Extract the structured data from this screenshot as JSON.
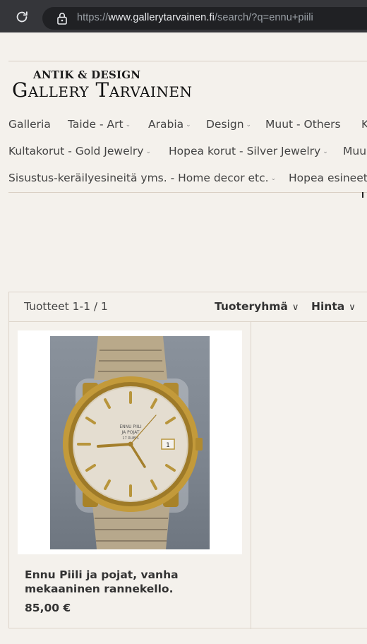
{
  "browser": {
    "url_prefix": "https://",
    "url_host": "www.gallerytarvainen.fi",
    "url_path": "/search/?q=ennu+piili"
  },
  "logo": {
    "line1": "ANTIK & DESIGN",
    "line2": "Gallery Tarvainen"
  },
  "nav": {
    "row1": [
      "Galleria",
      "Taide - Art",
      "Arabia",
      "Design",
      "Muut - Others",
      "K"
    ],
    "row2": [
      "Kultakorut - Gold Jewelry",
      "Hopea korut - Silver Jewelry",
      "Muu"
    ],
    "row3": [
      "Sisustus-keräilyesineitä yms. - Home decor etc.",
      "Hopea esineet"
    ]
  },
  "listing": {
    "count": "Tuotteet 1-1 / 1",
    "filters": [
      "Tuoteryhmä",
      "Hinta"
    ]
  },
  "products": [
    {
      "name": "Ennu Piili ja pojat, vanha mekaaninen rannekello.",
      "price": "85,00 €",
      "image": "gold-wristwatch-photo",
      "dial_text": [
        "ENNU PIILI",
        "JA POJAT",
        "17 RUBIS"
      ]
    }
  ],
  "colors": {
    "page_bg": "#f4f1ec",
    "browser_bar": "#35363a",
    "url_field": "#202124",
    "divider": "#d9cfc4"
  }
}
